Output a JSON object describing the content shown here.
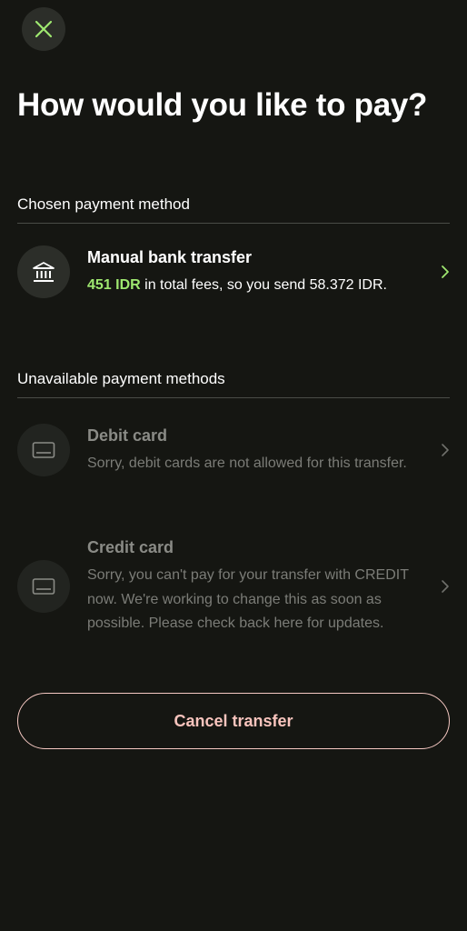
{
  "header": {
    "title": "How would you like to pay?"
  },
  "chosen_section": {
    "header": "Chosen payment method",
    "method": {
      "title": "Manual bank transfer",
      "fee": "451 IDR",
      "fee_suffix": " in total fees, so you send 58.372 IDR.",
      "icon": "bank-icon"
    }
  },
  "unavailable_section": {
    "header": "Unavailable payment methods",
    "methods": [
      {
        "title": "Debit card",
        "description": "Sorry, debit cards are not allowed for this transfer.",
        "icon": "card-icon"
      },
      {
        "title": "Credit card",
        "description": "Sorry, you can't pay for your transfer with CREDIT now. We're working to change this as soon as possible. Please check back here for updates.",
        "icon": "card-icon"
      }
    ]
  },
  "footer": {
    "cancel_label": "Cancel transfer"
  },
  "colors": {
    "background": "#151612",
    "accent_green": "#9fe870",
    "cancel_pink": "#f8c4bd",
    "icon_circle": "#2c2e29"
  }
}
